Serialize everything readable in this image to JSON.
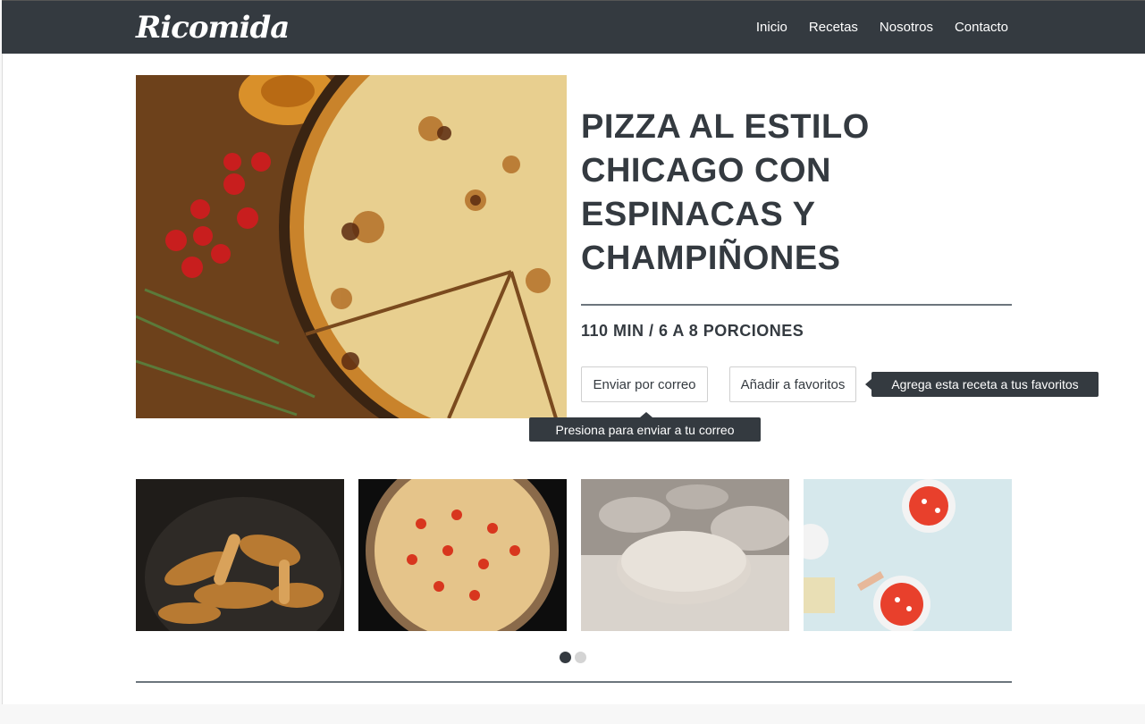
{
  "nav": {
    "brand": "Ricomida",
    "links": [
      "Inicio",
      "Recetas",
      "Nosotros",
      "Contacto"
    ]
  },
  "recipe": {
    "title": "PIZZA AL ESTILO CHICAGO CON ESPINACAS Y CHAMPIÑONES",
    "meta": "110 MIN / 6 A 8 PORCIONES",
    "email_button": "Enviar por correo",
    "fav_button": "Añadir a favoritos",
    "fav_tooltip": "Agrega esta receta a tus favoritos",
    "email_tooltip": "Presiona para enviar a tu correo"
  },
  "gallery": {
    "items": [
      "chanterelle mushrooms in bowl",
      "pizza in oven",
      "dough balls on floured surface",
      "hands topping pizzas"
    ],
    "active_dot": 1,
    "dot_count": 2
  },
  "colors": {
    "navbar": "#343a40",
    "text": "#343a40",
    "rule": "#6c757d"
  }
}
